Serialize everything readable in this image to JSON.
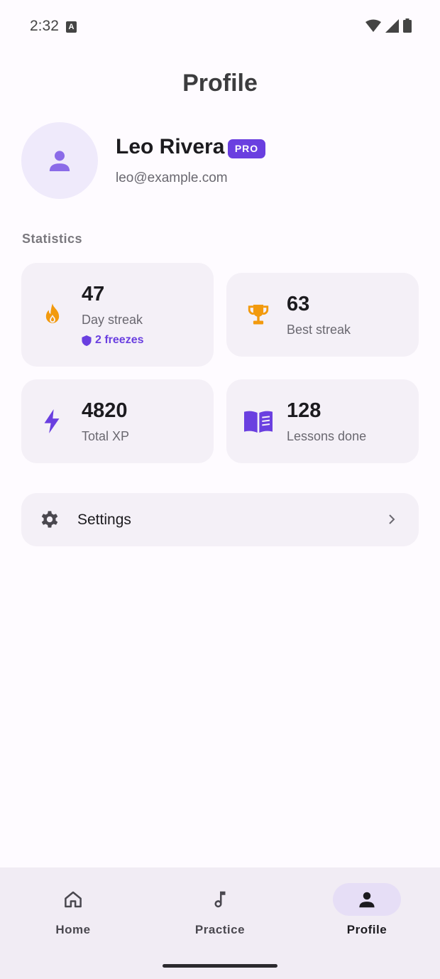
{
  "status_bar": {
    "time": "2:32",
    "notification_icon": "A"
  },
  "header": {
    "title": "Profile"
  },
  "profile": {
    "name": "Leo Rivera",
    "badge": "PRO",
    "email": "leo@example.com"
  },
  "statistics": {
    "section_label": "Statistics",
    "cards": [
      {
        "value": "47",
        "label": "Day streak",
        "icon": "flame-icon",
        "extra": "2 freezes",
        "extra_icon": "shield-icon"
      },
      {
        "value": "63",
        "label": "Best streak",
        "icon": "trophy-icon"
      },
      {
        "value": "4820",
        "label": "Total XP",
        "icon": "bolt-icon"
      },
      {
        "value": "128",
        "label": "Lessons done",
        "icon": "book-icon"
      }
    ]
  },
  "settings": {
    "label": "Settings",
    "icon": "gear-icon"
  },
  "bottom_nav": {
    "items": [
      {
        "label": "Home",
        "icon": "home-icon"
      },
      {
        "label": "Practice",
        "icon": "music-note-icon"
      },
      {
        "label": "Profile",
        "icon": "person-icon",
        "active": true
      }
    ]
  },
  "colors": {
    "accent": "#6a3fe0",
    "orange": "#f29a0e",
    "card_bg": "#f4f0f7",
    "nav_bg": "#f1ecf4"
  }
}
